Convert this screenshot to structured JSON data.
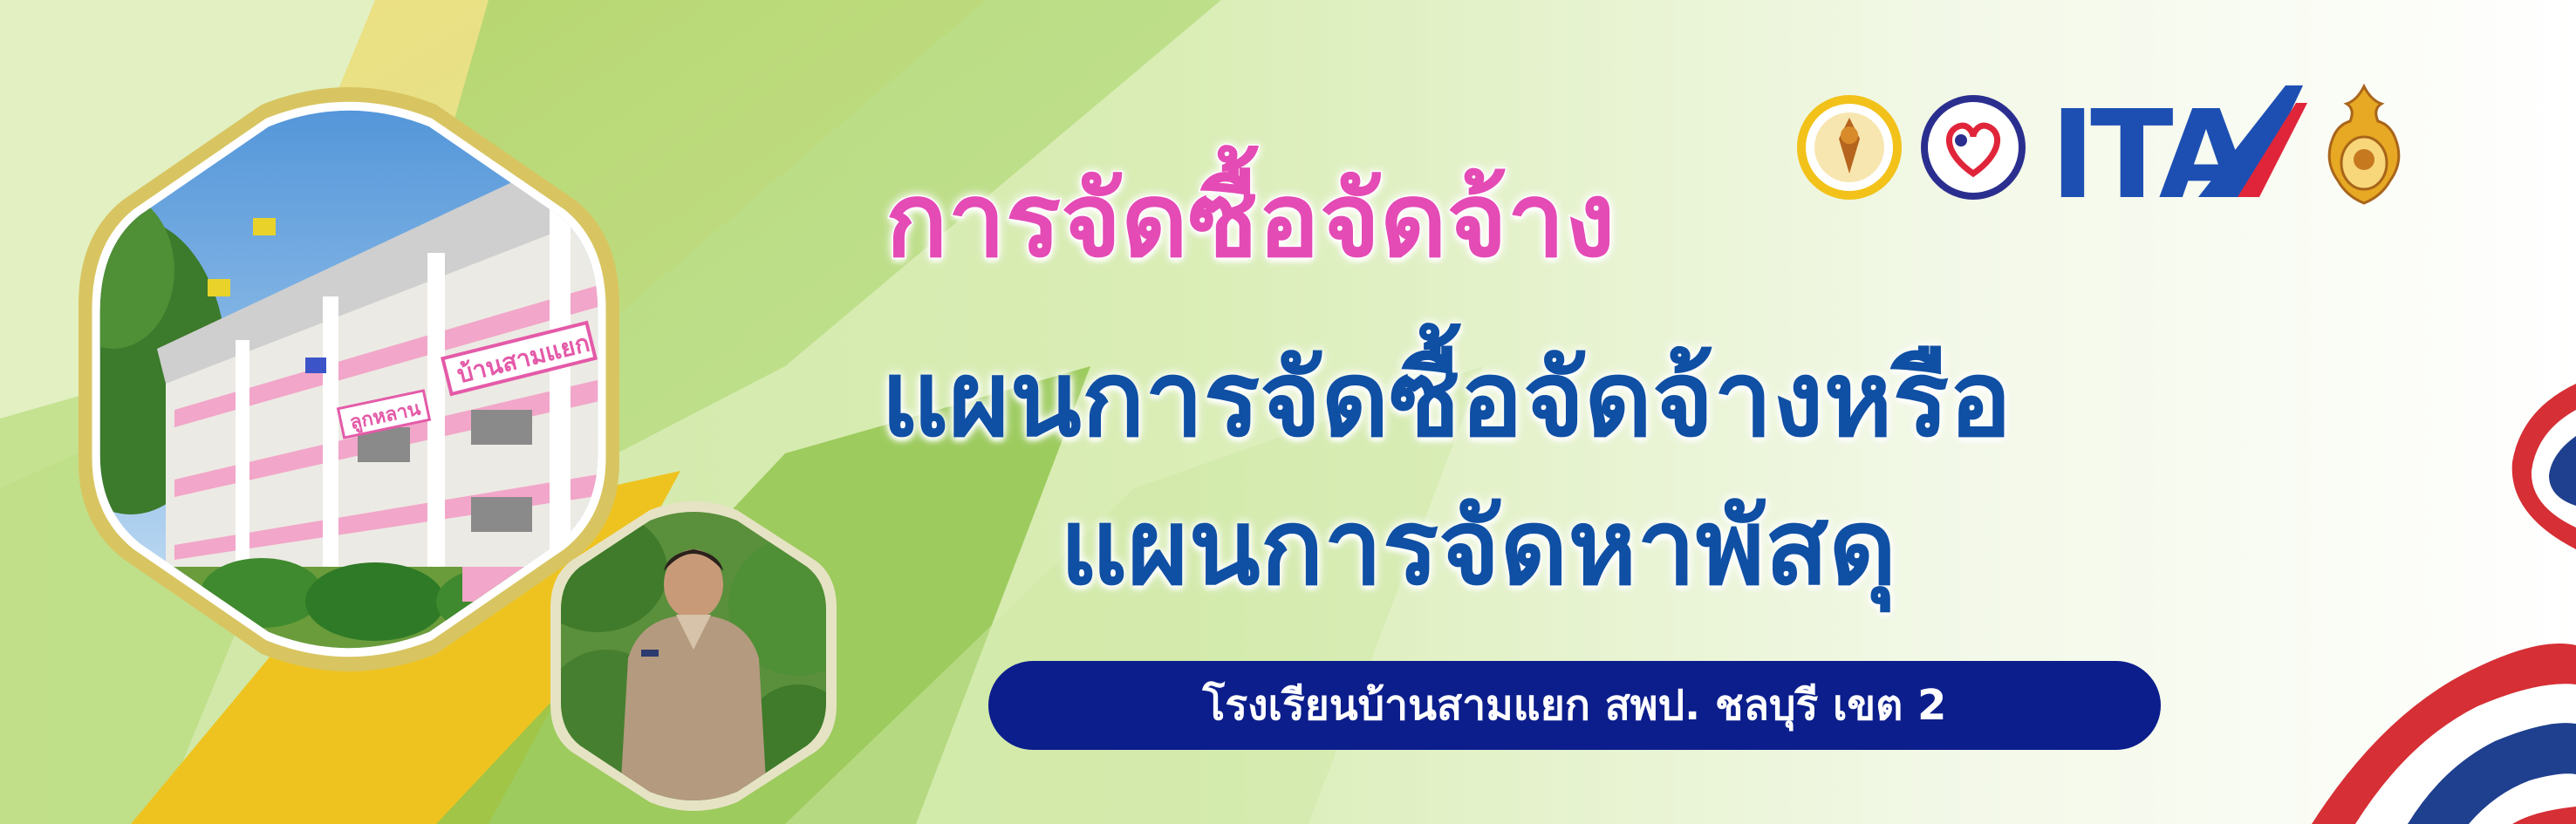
{
  "banner": {
    "title_pink": "การจัดซื้อจัดจ้าง",
    "title_blue_line1": "แผนการจัดซื้อจัดจ้างหรือ",
    "title_blue_line2": "แผนการจัดหาพัสดุ",
    "school_name": "โรงเรียนบ้านสามแยก สพป. ชลบุรี เขต 2"
  },
  "logos": {
    "ita_text": "ITA",
    "items": [
      "school-seal-logo",
      "heart-emblem-logo",
      "ita-logo",
      "obec-emblem-logo"
    ]
  },
  "photos": {
    "building_sign": "บ้านสามแยก",
    "building_sign_2": "ลูกหลาน"
  },
  "colors": {
    "pink": "#e44bb4",
    "blue": "#0f4fa4",
    "pill": "#0c1e8c",
    "ita": "#1d4fb3"
  }
}
